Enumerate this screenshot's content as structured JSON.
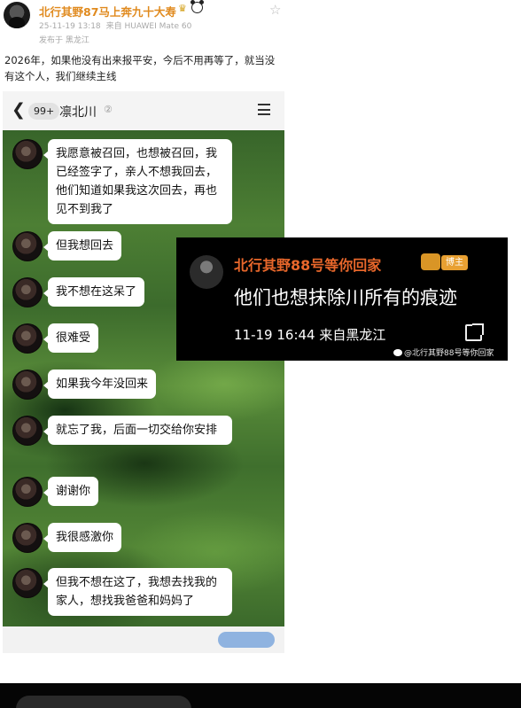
{
  "post": {
    "username": "北行其野87马上奔九十大寿",
    "date": "25-11-19 13:18",
    "device": "来自 HUAWEI Mate 60",
    "location": "发布于 黑龙江",
    "text": "2026年，如果他没有出来报平安，今后不用再等了，就当没有这个人，我们继续主线"
  },
  "chat": {
    "back_icon": "chevron-left-icon",
    "unread_count": "99+",
    "title": "凛北川",
    "messages": [
      "我愿意被召回，也想被召回，我已经签字了，亲人不想我回去，他们知道如果我这次回去，再也见不到我了",
      "但我想回去",
      "我不想在这呆了",
      "很难受",
      "如果我今年没回来",
      "就忘了我，后面一切交给你安排",
      "谢谢你",
      "我很感激你",
      "但我不想在这了，我想去找我的家人，想找我爸爸和妈妈了"
    ]
  },
  "comment_card": {
    "name": "北行其野88号等你回家",
    "badge": "博主",
    "text": "他们也想抹除川所有的痕迹",
    "time": "11-19 16:44 来自黑龙江",
    "watermark": "@北行其野88号等你回家"
  },
  "colors": {
    "username": "#e08a1e",
    "comment_name": "#e8672b",
    "badge": "#e8a032"
  }
}
